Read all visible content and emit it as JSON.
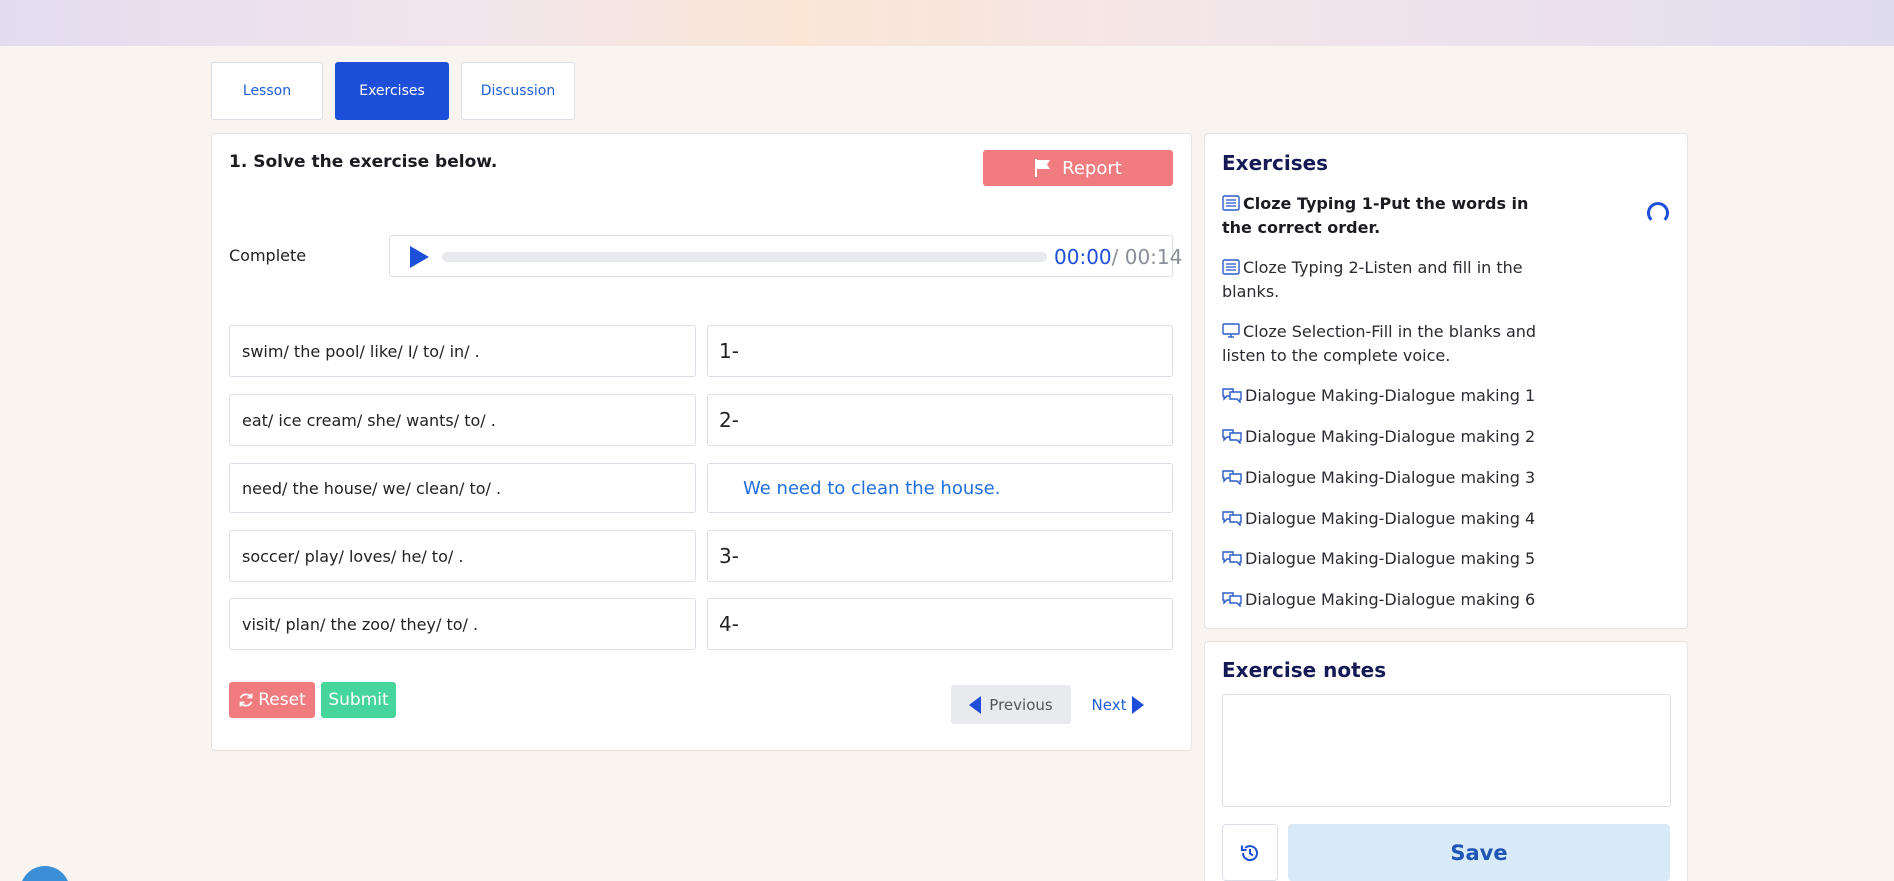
{
  "tabs": [
    {
      "label": "Lesson",
      "active": false
    },
    {
      "label": "Exercises",
      "active": true
    },
    {
      "label": "Discussion",
      "active": false
    }
  ],
  "exercise": {
    "title": "1. Solve the exercise below.",
    "report_label": "Report",
    "complete_label": "Complete",
    "audio": {
      "current": "00:00",
      "total": "/ 00:14"
    },
    "rows": [
      {
        "prompt": "swim/ the pool/ like/ I/ to/ in/ .",
        "answer": "1-"
      },
      {
        "prompt": "eat/ ice cream/ she/ wants/ to/ .",
        "answer": "2-"
      },
      {
        "prompt": "need/ the house/ we/ clean/ to/ .",
        "answer": "We need to clean the house."
      },
      {
        "prompt": "soccer/ play/ loves/ he/ to/ .",
        "answer": "3-"
      },
      {
        "prompt": "visit/ plan/ the zoo/ they/ to/ .",
        "answer": "4-"
      }
    ],
    "reset_label": "Reset",
    "submit_label": "Submit",
    "previous_label": "Previous",
    "next_label": "Next"
  },
  "sidebar": {
    "title": "Exercises",
    "items": [
      {
        "label": "Cloze Typing 1-Put the words in the correct order.",
        "icon": "list-icon",
        "current": true
      },
      {
        "label": "Cloze Typing 2-Listen and fill in the blanks.",
        "icon": "list-icon",
        "current": false
      },
      {
        "label": "Cloze Selection-Fill in the blanks and listen to the complete voice.",
        "icon": "monitor-icon",
        "current": false
      },
      {
        "label": "Dialogue Making-Dialogue making 1",
        "icon": "dialogue-icon",
        "current": false
      },
      {
        "label": "Dialogue Making-Dialogue making 2",
        "icon": "dialogue-icon",
        "current": false
      },
      {
        "label": "Dialogue Making-Dialogue making 3",
        "icon": "dialogue-icon",
        "current": false
      },
      {
        "label": "Dialogue Making-Dialogue making 4",
        "icon": "dialogue-icon",
        "current": false
      },
      {
        "label": "Dialogue Making-Dialogue making 5",
        "icon": "dialogue-icon",
        "current": false
      },
      {
        "label": "Dialogue Making-Dialogue making 6",
        "icon": "dialogue-icon",
        "current": false
      }
    ]
  },
  "notes": {
    "title": "Exercise notes",
    "text": "",
    "save_label": "Save"
  },
  "colors": {
    "primary": "#1e4fd8",
    "danger": "#f07c80",
    "success": "#46d59b",
    "save_bg": "#d8eaf8"
  }
}
